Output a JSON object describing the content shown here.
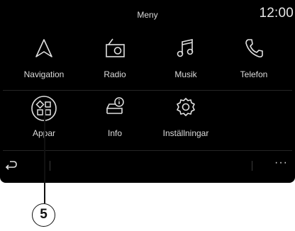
{
  "header": {
    "title": "Meny",
    "clock": "12:00"
  },
  "apps": [
    {
      "label": "Navigation",
      "icon": "navigation-arrow-icon"
    },
    {
      "label": "Radio",
      "icon": "radio-icon"
    },
    {
      "label": "Musik",
      "icon": "music-note-icon"
    },
    {
      "label": "Telefon",
      "icon": "phone-icon"
    },
    {
      "label": "Appar",
      "icon": "apps-grid-icon"
    },
    {
      "label": "Info",
      "icon": "car-info-icon"
    },
    {
      "label": "Inställningar",
      "icon": "gear-icon"
    }
  ],
  "footer": {
    "back_icon": "back-arrow-icon",
    "more_label": "···"
  },
  "callout": {
    "number": "5"
  },
  "colors": {
    "screen_bg": "#000000",
    "text": "#dcdcdc",
    "line": "#252525"
  }
}
